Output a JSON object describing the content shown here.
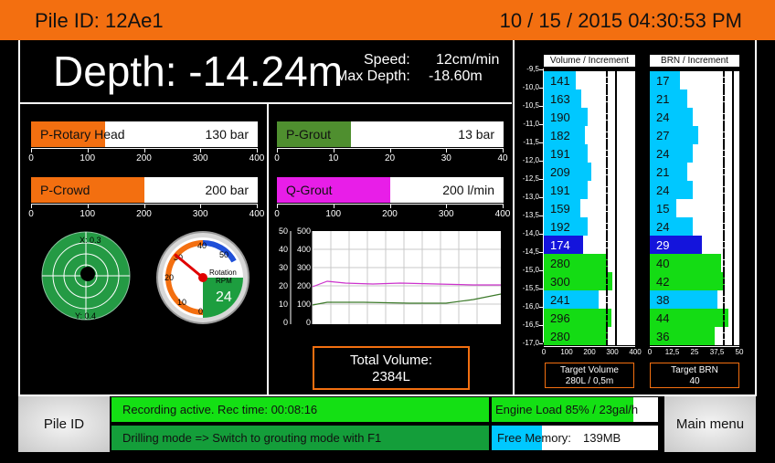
{
  "header": {
    "pile_id": "Pile ID: 12Ae1",
    "datetime": "10 / 15 / 2015 04:30:53 PM"
  },
  "depth": {
    "depth_text": "Depth: -14.24m",
    "speed_label": "Speed:",
    "speed_value": "12cm/min",
    "max_label": "Max Depth:",
    "max_value": "-18.60m"
  },
  "gauges": {
    "rotary": {
      "label": "P-Rotary Head",
      "value": "130 bar",
      "fraction": 0.325,
      "color": "#f36f10",
      "ticks": [
        "0",
        "100",
        "200",
        "300",
        "400"
      ]
    },
    "grout": {
      "label": "P-Grout",
      "value": "13 bar",
      "fraction": 0.325,
      "color": "#4f8f2f",
      "ticks": [
        "0",
        "10",
        "20",
        "30",
        "40"
      ]
    },
    "crowd": {
      "label": "P-Crowd",
      "value": "200 bar",
      "fraction": 0.5,
      "color": "#f36f10",
      "ticks": [
        "0",
        "100",
        "200",
        "300",
        "400"
      ]
    },
    "qgrout": {
      "label": "Q-Grout",
      "value": "200 l/min",
      "fraction": 0.5,
      "color": "#e81ee8",
      "ticks": [
        "0",
        "100",
        "200",
        "300",
        "400"
      ]
    }
  },
  "inclination": {
    "x_label": "X: 0.3",
    "y_label": "Y: 0.4"
  },
  "rotation": {
    "label1": "Rotation",
    "label2": "RPM",
    "value": "24",
    "scale": [
      "0",
      "10",
      "20",
      "30",
      "40",
      "50"
    ],
    "rpm": 24
  },
  "trend_chart": {
    "left_ticks": [
      "50",
      "40",
      "30",
      "20",
      "10",
      "0"
    ],
    "right_ticks": [
      "500",
      "400",
      "300",
      "200",
      "100",
      "0"
    ]
  },
  "total_volume": {
    "label": "Total Volume:",
    "value": "2384L"
  },
  "depth_scale": [
    "-9,5",
    "-10,0",
    "-10,5",
    "-11,0",
    "-11,5",
    "-12,0",
    "-12,5",
    "-13,0",
    "-13,5",
    "-14,0",
    "-14,5",
    "-15,0",
    "-15,5",
    "-16,0",
    "-16,5",
    "-17,0"
  ],
  "volume_table": {
    "title": "Volume / Increment",
    "values": [
      "141",
      "163",
      "190",
      "182",
      "191",
      "209",
      "191",
      "159",
      "192",
      "174",
      "280",
      "300",
      "241",
      "296",
      "280"
    ],
    "fractions": [
      0.35,
      0.41,
      0.48,
      0.45,
      0.48,
      0.52,
      0.48,
      0.4,
      0.48,
      0.43,
      0.7,
      0.75,
      0.6,
      0.74,
      0.7
    ],
    "colors": [
      "cyan",
      "cyan",
      "cyan",
      "cyan",
      "cyan",
      "cyan",
      "cyan",
      "cyan",
      "cyan",
      "blue",
      "green",
      "green",
      "cyan",
      "green",
      "green"
    ],
    "axis": [
      "0",
      "100",
      "200",
      "300",
      "400"
    ],
    "target_line1": "Target Volume",
    "target_line2": "280L / 0,5m"
  },
  "brn_table": {
    "title": "BRN / Increment",
    "values": [
      "17",
      "21",
      "24",
      "27",
      "24",
      "21",
      "24",
      "15",
      "24",
      "29",
      "40",
      "42",
      "38",
      "44",
      "36"
    ],
    "fractions": [
      0.34,
      0.42,
      0.48,
      0.54,
      0.48,
      0.42,
      0.48,
      0.3,
      0.48,
      0.58,
      0.8,
      0.84,
      0.76,
      0.88,
      0.72
    ],
    "colors": [
      "cyan",
      "cyan",
      "cyan",
      "cyan",
      "cyan",
      "cyan",
      "cyan",
      "cyan",
      "cyan",
      "blue",
      "green",
      "green",
      "cyan",
      "green",
      "green"
    ],
    "axis": [
      "0",
      "12,5",
      "25",
      "37,5",
      "50"
    ],
    "target_line1": "Target BRN",
    "target_line2": "40"
  },
  "palette": {
    "cyan": "#00c8ff",
    "blue": "#1414dc",
    "green": "#14dc14"
  },
  "status": {
    "recording": "Recording active. Rec time: 00:08:16",
    "mode": "Drilling mode => Switch to grouting mode with F1",
    "engine": "Engine Load 85% / 23gal/h",
    "engine_fraction": 0.85,
    "memory_label": "Free Memory:",
    "memory_value": "139MB",
    "memory_fraction": 0.3
  },
  "buttons": {
    "pile_id": "Pile ID",
    "main_menu": "Main menu"
  }
}
